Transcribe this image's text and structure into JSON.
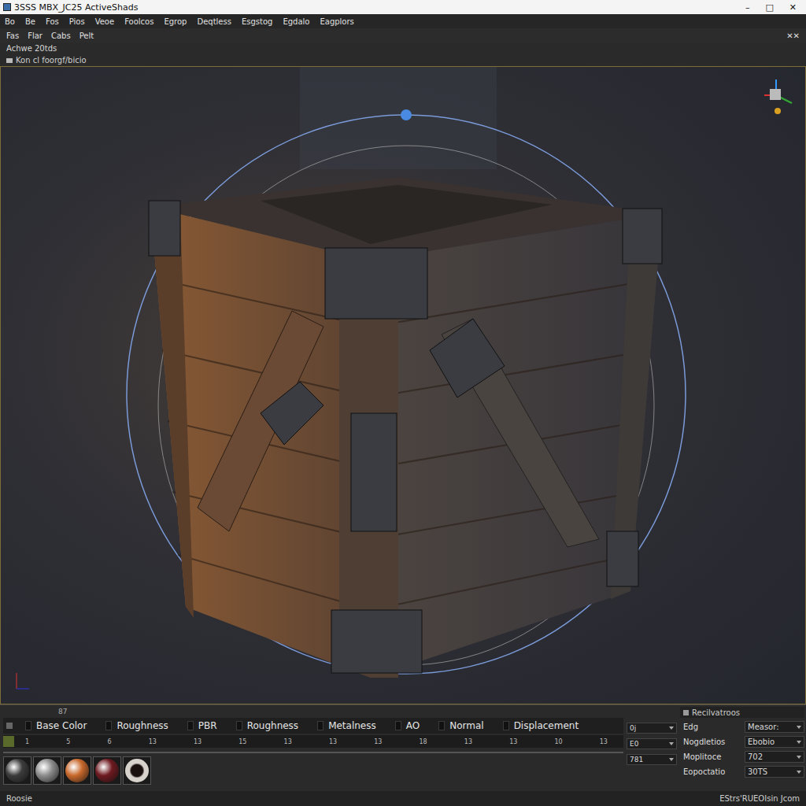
{
  "window": {
    "title": "3SSS MBX_JC25 ActiveShads",
    "controls": [
      "–",
      "□",
      "✕"
    ]
  },
  "menu_bar": [
    "Bo",
    "Be",
    "Fos",
    "Pios",
    "Veoe",
    "Foolcos",
    "Egrop",
    "Deqtless",
    "Esgstog",
    "Egdalo",
    "Eagplors"
  ],
  "toolbar": {
    "items": [
      "Fas",
      "Flar",
      "Cabs",
      "Pelt"
    ],
    "close": "✕✕"
  },
  "viewport": {
    "label": "Achwe 20tds",
    "sublabel": "Kon cl foorgf/bicio"
  },
  "material_panel": {
    "counter": "87",
    "tabs": [
      {
        "label": "Base Color",
        "selected": false
      },
      {
        "label": "Roughness",
        "selected": false
      },
      {
        "label": "PBR",
        "selected": false
      },
      {
        "label": "Roughness",
        "selected": false
      },
      {
        "label": "Metalness",
        "selected": false
      },
      {
        "label": "AO",
        "selected": false
      },
      {
        "label": "Normal",
        "selected": false
      },
      {
        "label": "Displacement",
        "selected": false
      }
    ],
    "timeline_ticks": [
      "1",
      "5",
      "6",
      "13",
      "13",
      "15",
      "13",
      "13",
      "13",
      "18",
      "13",
      "13",
      "10",
      "13"
    ],
    "scrub": {
      "level": 0.02
    },
    "swatches": [
      {
        "color": "#3c3c3c"
      },
      {
        "color": "#8c8c8c"
      },
      {
        "color": "#c8682c"
      },
      {
        "color": "#6e1a20"
      },
      {
        "color": "#d8d2cc"
      }
    ],
    "dropdowns": [
      "0j",
      "E0",
      "781"
    ]
  },
  "properties": {
    "title": "Recilvatroos",
    "rows": [
      {
        "label": "Edg",
        "value": "Measor:"
      },
      {
        "label": "Nogdletios",
        "value": "Ebobio"
      },
      {
        "label": "Moplitoce",
        "value": "702"
      },
      {
        "label": "Eopoctatio",
        "value": "30TS"
      }
    ]
  },
  "status_bar": {
    "left": "Roosie",
    "right": "EStrs'RUEOIsin Jcom"
  }
}
